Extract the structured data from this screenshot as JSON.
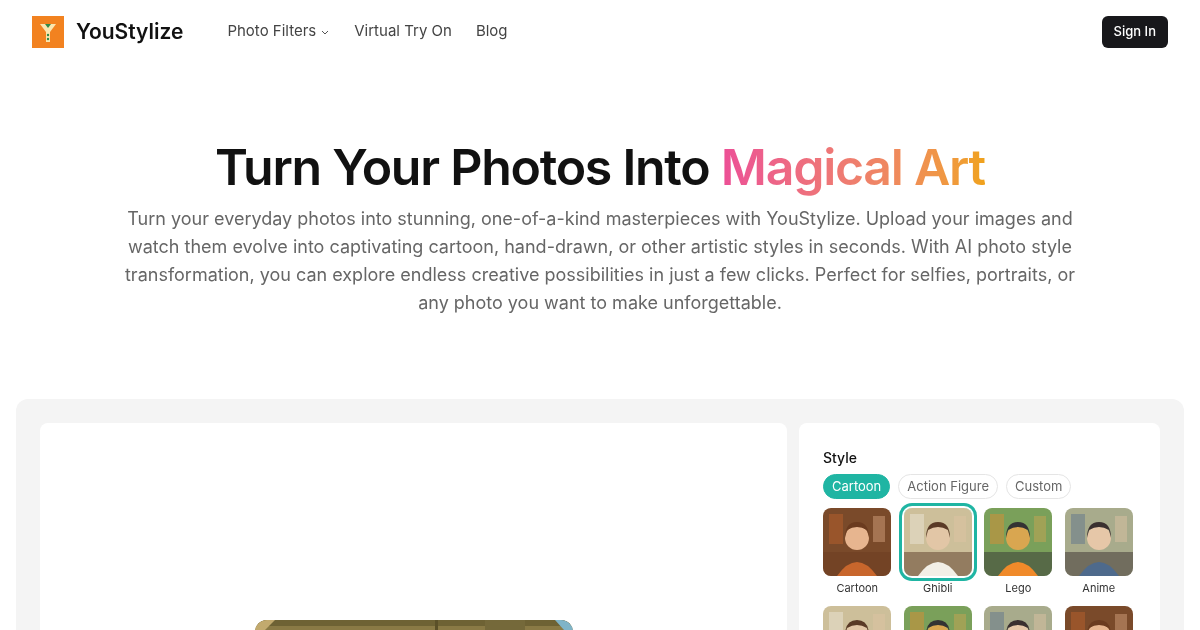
{
  "brand": {
    "name": "YouStylize"
  },
  "nav": [
    {
      "label": "Photo Filters",
      "kind": "dropdown"
    },
    {
      "label": "Virtual Try On",
      "kind": "link"
    },
    {
      "label": "Blog",
      "kind": "link"
    }
  ],
  "sign_in": "Sign In",
  "hero": {
    "title": "Turn Your Photos Into ",
    "highlight": "Magical Art",
    "text": "Turn your everyday photos into stunning, one-of-a-kind masterpieces with YouStylize. Upload your images and watch them evolve into captivating cartoon, hand-drawn, or other artistic styles in seconds. With AI photo style transformation, you can explore endless creative possibilities in just a few clicks. Perfect for selfies, portraits, or any photo you want to make unforgettable."
  },
  "style_panel": {
    "heading": "Style",
    "tabs": [
      {
        "label": "Cartoon",
        "selected": true
      },
      {
        "label": "Action Figure",
        "selected": false
      },
      {
        "label": "Custom",
        "selected": false
      }
    ],
    "styles": [
      {
        "label": "Cartoon",
        "selected": false
      },
      {
        "label": "Ghibli",
        "selected": true
      },
      {
        "label": "Lego",
        "selected": false
      },
      {
        "label": "Anime",
        "selected": false
      }
    ]
  }
}
